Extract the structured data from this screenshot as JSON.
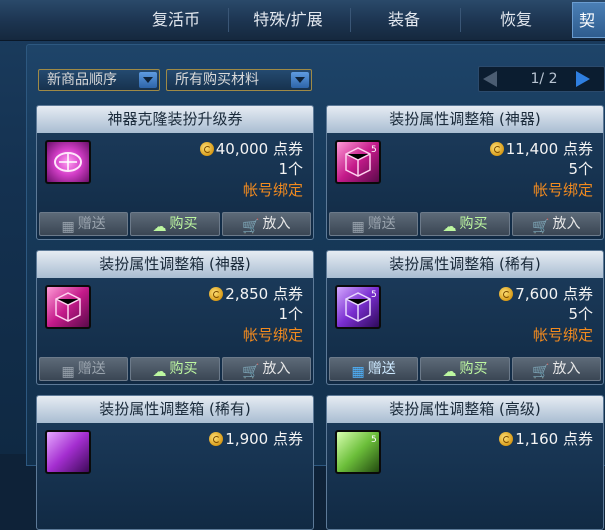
{
  "tabs": [
    {
      "label": "复活币"
    },
    {
      "label": "特殊/扩展"
    },
    {
      "label": "装备"
    },
    {
      "label": "恢复"
    },
    {
      "label": "契"
    }
  ],
  "filters": {
    "sort_label": "新商品顺序",
    "material_label": "所有购买材料"
  },
  "pager": {
    "text": "1/ 2"
  },
  "actions": {
    "gift_label": "赠送",
    "buy_label": "购买",
    "cart_label": "放入"
  },
  "currency_icon": "coupon-coin-icon",
  "colors": {
    "bound_text": "#f18a1f",
    "buy_text": "#bdf7a0",
    "title_bar": "#d7e1ec"
  },
  "items": [
    {
      "title": "神器克隆装扮升级券",
      "price": "40,000 点券",
      "qty": "1个",
      "bound": "帐号绑定",
      "icon": "pink-rune-icon",
      "gift_enabled": false
    },
    {
      "title": "装扮属性调整箱 (神器)",
      "price": "11,400 点券",
      "qty": "5个",
      "bound": "帐号绑定",
      "icon": "pink-box-icon",
      "badge": "5",
      "gift_enabled": false
    },
    {
      "title": "装扮属性调整箱 (神器)",
      "price": "2,850 点券",
      "qty": "1个",
      "bound": "帐号绑定",
      "icon": "pink-box-icon",
      "gift_enabled": false
    },
    {
      "title": "装扮属性调整箱 (稀有)",
      "price": "7,600 点券",
      "qty": "5个",
      "bound": "帐号绑定",
      "icon": "purple-box-icon",
      "badge": "5",
      "gift_enabled": true
    },
    {
      "title": "装扮属性调整箱 (稀有)",
      "price": "1,900 点券",
      "icon": "purple-box-icon"
    },
    {
      "title": "装扮属性调整箱 (高级)",
      "price": "1,160 点券",
      "icon": "green-box-icon",
      "badge": "5"
    }
  ]
}
